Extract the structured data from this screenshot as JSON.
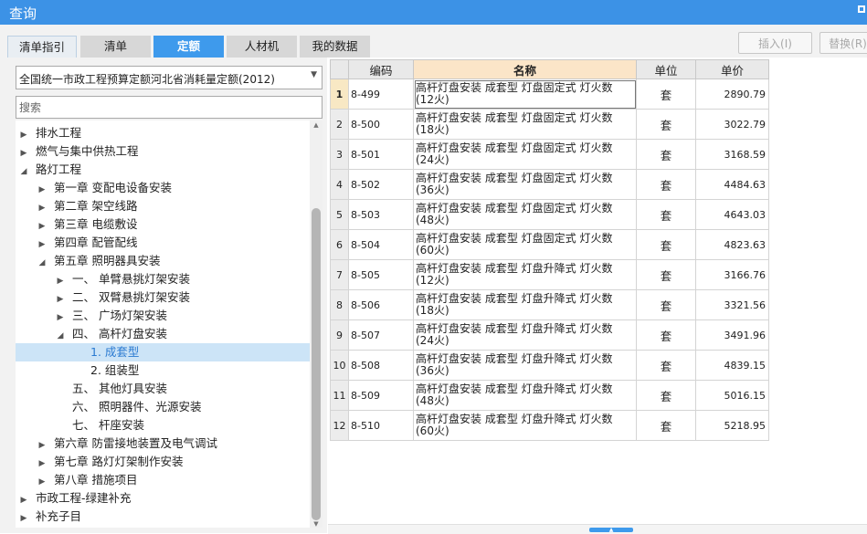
{
  "window": {
    "title": "查询"
  },
  "tabs": [
    {
      "label": "清单指引",
      "active": false
    },
    {
      "label": "清单",
      "active": false
    },
    {
      "label": "定额",
      "active": true
    },
    {
      "label": "人材机",
      "active": false
    },
    {
      "label": "我的数据",
      "active": false
    }
  ],
  "toolbar": {
    "insert_label": "插入(I)",
    "replace_label": "替换(R)"
  },
  "left": {
    "quota_db": "全国统一市政工程预算定额河北省消耗量定额(2012)",
    "search_placeholder": "搜索",
    "tree": [
      {
        "label": "排水工程",
        "level": 0,
        "expander": "collapsed"
      },
      {
        "label": "燃气与集中供热工程",
        "level": 0,
        "expander": "collapsed"
      },
      {
        "label": "路灯工程",
        "level": 0,
        "expander": "expanded"
      },
      {
        "label": "第一章  变配电设备安装",
        "level": 1,
        "expander": "collapsed"
      },
      {
        "label": "第二章  架空线路",
        "level": 1,
        "expander": "collapsed"
      },
      {
        "label": "第三章  电缆敷设",
        "level": 1,
        "expander": "collapsed"
      },
      {
        "label": "第四章  配管配线",
        "level": 1,
        "expander": "collapsed"
      },
      {
        "label": "第五章  照明器具安装",
        "level": 1,
        "expander": "expanded"
      },
      {
        "label": "一、  单臂悬挑灯架安装",
        "level": 2,
        "expander": "collapsed"
      },
      {
        "label": "二、  双臂悬挑灯架安装",
        "level": 2,
        "expander": "collapsed"
      },
      {
        "label": "三、  广场灯架安装",
        "level": 2,
        "expander": "collapsed"
      },
      {
        "label": "四、  高杆灯盘安装",
        "level": 2,
        "expander": "expanded"
      },
      {
        "label": "1. 成套型",
        "level": 3,
        "expander": "none",
        "selected": true
      },
      {
        "label": "2. 组装型",
        "level": 3,
        "expander": "none"
      },
      {
        "label": "五、  其他灯具安装",
        "level": 2,
        "expander": "none"
      },
      {
        "label": "六、  照明器件、光源安装",
        "level": 2,
        "expander": "none"
      },
      {
        "label": "七、  杆座安装",
        "level": 2,
        "expander": "none"
      },
      {
        "label": "第六章  防雷接地装置及电气调试",
        "level": 1,
        "expander": "collapsed"
      },
      {
        "label": "第七章  路灯灯架制作安装",
        "level": 1,
        "expander": "collapsed"
      },
      {
        "label": "第八章  措施项目",
        "level": 1,
        "expander": "collapsed"
      },
      {
        "label": "市政工程-绿建补充",
        "level": 0,
        "expander": "collapsed"
      },
      {
        "label": "补充子目",
        "level": 0,
        "expander": "collapsed"
      }
    ]
  },
  "grid": {
    "columns": [
      "编码",
      "名称",
      "单位",
      "单价"
    ],
    "rows": [
      {
        "n": "1",
        "code": "8-499",
        "name": "高杆灯盘安装 成套型 灯盘固定式 灯火数\n(12火)",
        "unit": "套",
        "price": "2890.79"
      },
      {
        "n": "2",
        "code": "8-500",
        "name": "高杆灯盘安装 成套型 灯盘固定式 灯火数\n(18火)",
        "unit": "套",
        "price": "3022.79"
      },
      {
        "n": "3",
        "code": "8-501",
        "name": "高杆灯盘安装 成套型 灯盘固定式 灯火数\n(24火)",
        "unit": "套",
        "price": "3168.59"
      },
      {
        "n": "4",
        "code": "8-502",
        "name": "高杆灯盘安装 成套型 灯盘固定式 灯火数\n(36火)",
        "unit": "套",
        "price": "4484.63"
      },
      {
        "n": "5",
        "code": "8-503",
        "name": "高杆灯盘安装 成套型 灯盘固定式 灯火数\n(48火)",
        "unit": "套",
        "price": "4643.03"
      },
      {
        "n": "6",
        "code": "8-504",
        "name": "高杆灯盘安装 成套型 灯盘固定式 灯火数\n(60火)",
        "unit": "套",
        "price": "4823.63"
      },
      {
        "n": "7",
        "code": "8-505",
        "name": "高杆灯盘安装 成套型 灯盘升降式 灯火数\n(12火)",
        "unit": "套",
        "price": "3166.76"
      },
      {
        "n": "8",
        "code": "8-506",
        "name": "高杆灯盘安装 成套型 灯盘升降式 灯火数\n(18火)",
        "unit": "套",
        "price": "3321.56"
      },
      {
        "n": "9",
        "code": "8-507",
        "name": "高杆灯盘安装 成套型 灯盘升降式 灯火数\n(24火)",
        "unit": "套",
        "price": "3491.96"
      },
      {
        "n": "10",
        "code": "8-508",
        "name": "高杆灯盘安装 成套型 灯盘升降式 灯火数\n(36火)",
        "unit": "套",
        "price": "4839.15"
      },
      {
        "n": "11",
        "code": "8-509",
        "name": "高杆灯盘安装 成套型 灯盘升降式 灯火数\n(48火)",
        "unit": "套",
        "price": "5016.15"
      },
      {
        "n": "12",
        "code": "8-510",
        "name": "高杆灯盘安装 成套型 灯盘升降式 灯火数\n(60火)",
        "unit": "套",
        "price": "5218.95"
      }
    ]
  },
  "colors": {
    "accent": "#3e9aec",
    "titlebar": "#3c92e6",
    "selection": "#cce4f7"
  }
}
